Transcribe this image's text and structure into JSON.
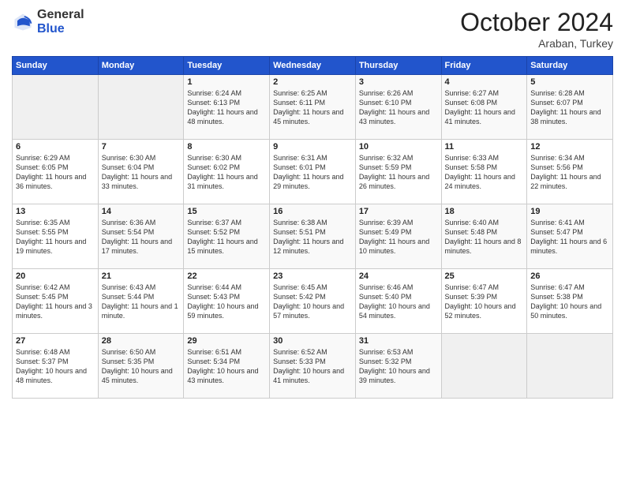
{
  "logo": {
    "general": "General",
    "blue": "Blue"
  },
  "header": {
    "month": "October 2024",
    "location": "Araban, Turkey"
  },
  "weekdays": [
    "Sunday",
    "Monday",
    "Tuesday",
    "Wednesday",
    "Thursday",
    "Friday",
    "Saturday"
  ],
  "weeks": [
    [
      {
        "day": "",
        "content": ""
      },
      {
        "day": "",
        "content": ""
      },
      {
        "day": "1",
        "content": "Sunrise: 6:24 AM\nSunset: 6:13 PM\nDaylight: 11 hours and 48 minutes."
      },
      {
        "day": "2",
        "content": "Sunrise: 6:25 AM\nSunset: 6:11 PM\nDaylight: 11 hours and 45 minutes."
      },
      {
        "day": "3",
        "content": "Sunrise: 6:26 AM\nSunset: 6:10 PM\nDaylight: 11 hours and 43 minutes."
      },
      {
        "day": "4",
        "content": "Sunrise: 6:27 AM\nSunset: 6:08 PM\nDaylight: 11 hours and 41 minutes."
      },
      {
        "day": "5",
        "content": "Sunrise: 6:28 AM\nSunset: 6:07 PM\nDaylight: 11 hours and 38 minutes."
      }
    ],
    [
      {
        "day": "6",
        "content": "Sunrise: 6:29 AM\nSunset: 6:05 PM\nDaylight: 11 hours and 36 minutes."
      },
      {
        "day": "7",
        "content": "Sunrise: 6:30 AM\nSunset: 6:04 PM\nDaylight: 11 hours and 33 minutes."
      },
      {
        "day": "8",
        "content": "Sunrise: 6:30 AM\nSunset: 6:02 PM\nDaylight: 11 hours and 31 minutes."
      },
      {
        "day": "9",
        "content": "Sunrise: 6:31 AM\nSunset: 6:01 PM\nDaylight: 11 hours and 29 minutes."
      },
      {
        "day": "10",
        "content": "Sunrise: 6:32 AM\nSunset: 5:59 PM\nDaylight: 11 hours and 26 minutes."
      },
      {
        "day": "11",
        "content": "Sunrise: 6:33 AM\nSunset: 5:58 PM\nDaylight: 11 hours and 24 minutes."
      },
      {
        "day": "12",
        "content": "Sunrise: 6:34 AM\nSunset: 5:56 PM\nDaylight: 11 hours and 22 minutes."
      }
    ],
    [
      {
        "day": "13",
        "content": "Sunrise: 6:35 AM\nSunset: 5:55 PM\nDaylight: 11 hours and 19 minutes."
      },
      {
        "day": "14",
        "content": "Sunrise: 6:36 AM\nSunset: 5:54 PM\nDaylight: 11 hours and 17 minutes."
      },
      {
        "day": "15",
        "content": "Sunrise: 6:37 AM\nSunset: 5:52 PM\nDaylight: 11 hours and 15 minutes."
      },
      {
        "day": "16",
        "content": "Sunrise: 6:38 AM\nSunset: 5:51 PM\nDaylight: 11 hours and 12 minutes."
      },
      {
        "day": "17",
        "content": "Sunrise: 6:39 AM\nSunset: 5:49 PM\nDaylight: 11 hours and 10 minutes."
      },
      {
        "day": "18",
        "content": "Sunrise: 6:40 AM\nSunset: 5:48 PM\nDaylight: 11 hours and 8 minutes."
      },
      {
        "day": "19",
        "content": "Sunrise: 6:41 AM\nSunset: 5:47 PM\nDaylight: 11 hours and 6 minutes."
      }
    ],
    [
      {
        "day": "20",
        "content": "Sunrise: 6:42 AM\nSunset: 5:45 PM\nDaylight: 11 hours and 3 minutes."
      },
      {
        "day": "21",
        "content": "Sunrise: 6:43 AM\nSunset: 5:44 PM\nDaylight: 11 hours and 1 minute."
      },
      {
        "day": "22",
        "content": "Sunrise: 6:44 AM\nSunset: 5:43 PM\nDaylight: 10 hours and 59 minutes."
      },
      {
        "day": "23",
        "content": "Sunrise: 6:45 AM\nSunset: 5:42 PM\nDaylight: 10 hours and 57 minutes."
      },
      {
        "day": "24",
        "content": "Sunrise: 6:46 AM\nSunset: 5:40 PM\nDaylight: 10 hours and 54 minutes."
      },
      {
        "day": "25",
        "content": "Sunrise: 6:47 AM\nSunset: 5:39 PM\nDaylight: 10 hours and 52 minutes."
      },
      {
        "day": "26",
        "content": "Sunrise: 6:47 AM\nSunset: 5:38 PM\nDaylight: 10 hours and 50 minutes."
      }
    ],
    [
      {
        "day": "27",
        "content": "Sunrise: 6:48 AM\nSunset: 5:37 PM\nDaylight: 10 hours and 48 minutes."
      },
      {
        "day": "28",
        "content": "Sunrise: 6:50 AM\nSunset: 5:35 PM\nDaylight: 10 hours and 45 minutes."
      },
      {
        "day": "29",
        "content": "Sunrise: 6:51 AM\nSunset: 5:34 PM\nDaylight: 10 hours and 43 minutes."
      },
      {
        "day": "30",
        "content": "Sunrise: 6:52 AM\nSunset: 5:33 PM\nDaylight: 10 hours and 41 minutes."
      },
      {
        "day": "31",
        "content": "Sunrise: 6:53 AM\nSunset: 5:32 PM\nDaylight: 10 hours and 39 minutes."
      },
      {
        "day": "",
        "content": ""
      },
      {
        "day": "",
        "content": ""
      }
    ]
  ]
}
